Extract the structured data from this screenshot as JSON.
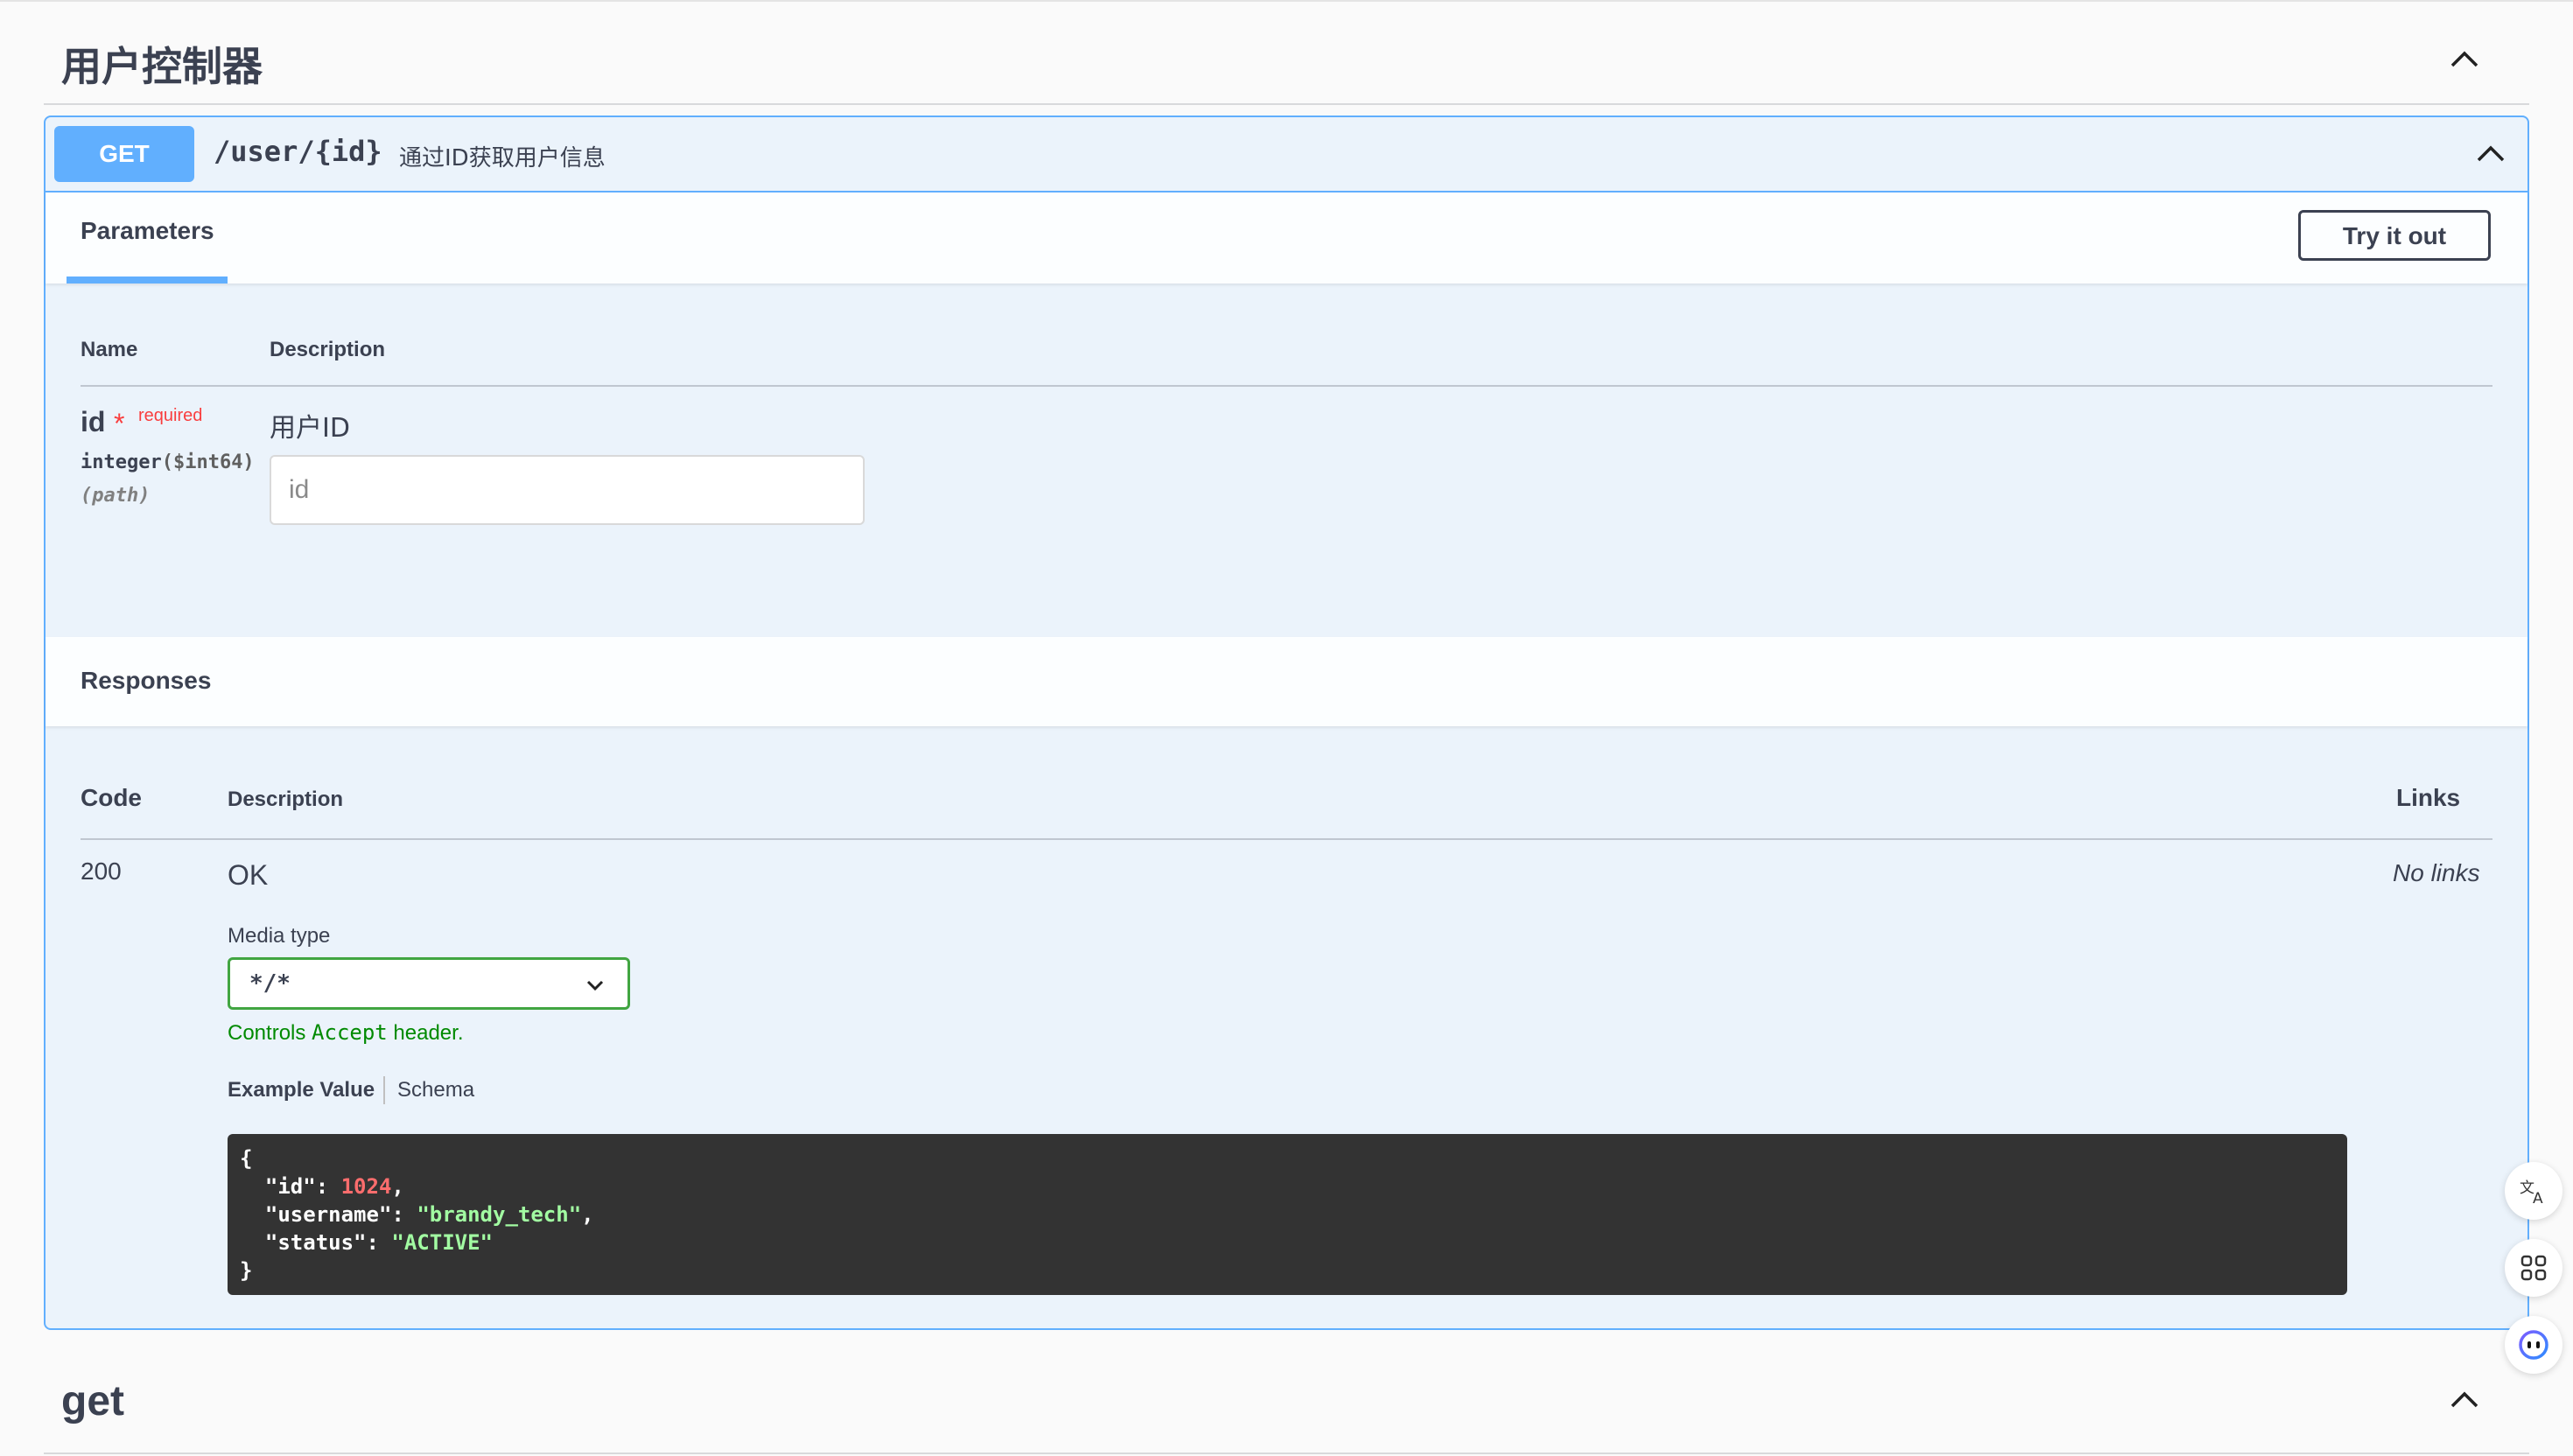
{
  "tag": {
    "title": "用户控制器"
  },
  "operation": {
    "method": "GET",
    "path": "/user/{id}",
    "summary": "通过ID获取用户信息",
    "params_tab": "Parameters",
    "try_button": "Try it out",
    "params_table": {
      "col_name": "Name",
      "col_description": "Description",
      "rows": [
        {
          "name": "id",
          "star": "*",
          "required_label": "required",
          "type": "integer",
          "format": "($int64)",
          "location": "(path)",
          "description": "用户ID",
          "placeholder": "id"
        }
      ]
    },
    "responses": {
      "title": "Responses",
      "col_code": "Code",
      "col_description": "Description",
      "col_links": "Links",
      "rows": [
        {
          "code": "200",
          "description": "OK",
          "links": "No links",
          "media_type_label": "Media type",
          "media_type_value": "*/*",
          "controls_prefix": "Controls ",
          "controls_code": "Accept",
          "controls_suffix": " header.",
          "tab_example": "Example Value",
          "tab_schema": "Schema",
          "example": {
            "open": "{",
            "id_key": "\"id\"",
            "id_value": "1024",
            "username_key": "\"username\"",
            "username_value": "\"brandy_tech\"",
            "status_key": "\"status\"",
            "status_value": "\"ACTIVE\"",
            "close": "}"
          }
        }
      ]
    }
  },
  "next_tag": {
    "title": "get"
  },
  "colors": {
    "get_method": "#61affe",
    "required": "#f93e3e",
    "media_valid": "#41a541",
    "help_green": "#008a00",
    "code_bg": "#333333"
  },
  "icons": [
    "chevron-up-icon",
    "chevron-down-icon",
    "translate-icon",
    "apps-grid-icon",
    "assistant-bot-icon"
  ]
}
